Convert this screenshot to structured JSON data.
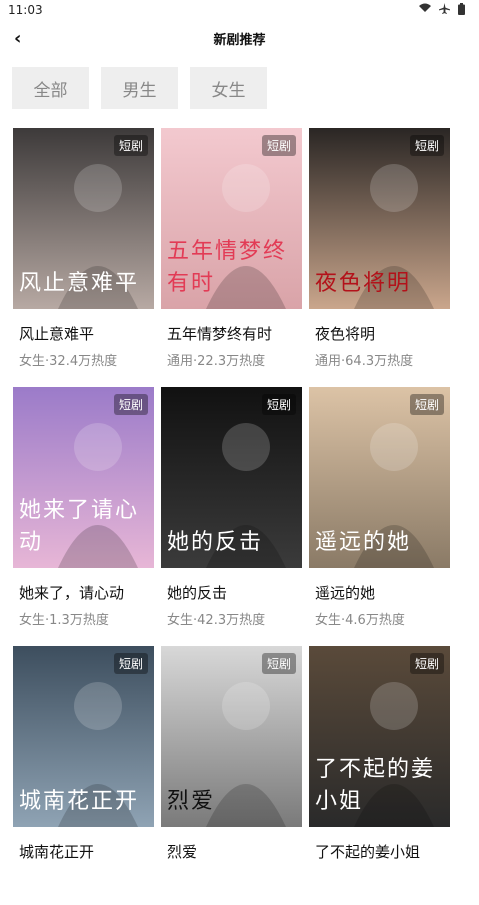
{
  "status": {
    "time": "11:03"
  },
  "header": {
    "back_label": "‹",
    "title": "新剧推荐"
  },
  "filters": [
    "全部",
    "男生",
    "女生"
  ],
  "badge_label": "短剧",
  "dramas": [
    {
      "name": "风止意难平",
      "category": "女生",
      "heat": "·32.4万热度",
      "overlay": "风止意难平",
      "overlay_color": "#ffffff",
      "colors": [
        "#3d3a3a",
        "#b7a9a3"
      ]
    },
    {
      "name": "五年情梦终有时",
      "category": "通用",
      "heat": "·22.3万热度",
      "overlay": "五年情梦终有时",
      "overlay_color": "#e23b55",
      "colors": [
        "#f3c9cf",
        "#d9a3a8"
      ]
    },
    {
      "name": "夜色将明",
      "category": "通用",
      "heat": "·64.3万热度",
      "overlay": "夜色将明",
      "overlay_color": "#b3121a",
      "colors": [
        "#2a2624",
        "#caa68c"
      ]
    },
    {
      "name": "她来了，请心动",
      "category": "女生",
      "heat": "·1.3万热度",
      "overlay": "她来了请心动",
      "overlay_color": "#ffffff",
      "colors": [
        "#9b7bc9",
        "#e7b6d6"
      ]
    },
    {
      "name": "她的反击",
      "category": "女生",
      "heat": "·42.3万热度",
      "overlay": "她的反击",
      "overlay_color": "#ffffff",
      "colors": [
        "#111111",
        "#3b3b3b"
      ]
    },
    {
      "name": "遥远的她",
      "category": "女生",
      "heat": "·4.6万热度",
      "overlay": "遥远的她",
      "overlay_color": "#ffffff",
      "colors": [
        "#dcc3a6",
        "#8a7a66"
      ]
    },
    {
      "name": "城南花正开",
      "category": "",
      "heat": "",
      "overlay": "城南花正开",
      "overlay_color": "#ffffff",
      "colors": [
        "#3d4e5e",
        "#8fa3b4"
      ]
    },
    {
      "name": "烈爱",
      "category": "",
      "heat": "",
      "overlay": "烈爱",
      "overlay_color": "#111111",
      "colors": [
        "#d8d8d8",
        "#7a7a7a"
      ]
    },
    {
      "name": "了不起的姜小姐",
      "category": "",
      "heat": "",
      "overlay": "了不起的姜小姐",
      "overlay_color": "#ffffff",
      "colors": [
        "#5a4a3a",
        "#2a2a2a"
      ]
    }
  ]
}
